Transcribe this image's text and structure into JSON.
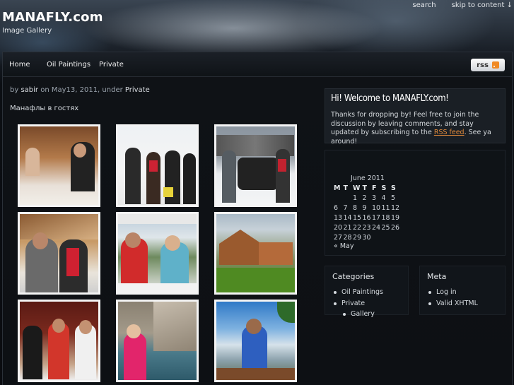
{
  "topbar": {
    "search": "search",
    "skip": "skip to content ↓"
  },
  "site": {
    "title": "MANAFLY.com",
    "description": "Image Gallery"
  },
  "nav": {
    "items": [
      "Home",
      "Oil Paintings",
      "Private"
    ],
    "rss_label": "rss"
  },
  "post": {
    "meta_by": "by",
    "author": "sabir",
    "meta_on": "on May13, 2011, under",
    "category": "Private",
    "title": "Манафлы в гостях"
  },
  "welcome": {
    "title": "Hi! Welcome to MANAFLY.com!",
    "text_before": "Thanks for dropping by! Feel free to join the discussion by leaving comments, and stay updated by subscribing to the",
    "link": "RSS feed",
    "text_after": ". See ya around!"
  },
  "calendar": {
    "caption": "June 2011",
    "headers": [
      "M",
      "T",
      "W",
      "T",
      "F",
      "S",
      "S"
    ],
    "weeks": [
      [
        "",
        "",
        "1",
        "2",
        "3",
        "4",
        "5"
      ],
      [
        "6",
        "7",
        "8",
        "9",
        "10",
        "11",
        "12"
      ],
      [
        "13",
        "14",
        "15",
        "16",
        "17",
        "18",
        "19"
      ],
      [
        "20",
        "21",
        "22",
        "23",
        "24",
        "25",
        "26"
      ],
      [
        "27",
        "28",
        "29",
        "30",
        "",
        "",
        ""
      ]
    ],
    "prev": "« May"
  },
  "categories": {
    "title": "Categories",
    "items": [
      "Oil Paintings",
      "Private"
    ],
    "sub": [
      "Gallery"
    ]
  },
  "meta_widget": {
    "title": "Meta",
    "items": [
      "Log in",
      "Valid XHTML"
    ]
  }
}
